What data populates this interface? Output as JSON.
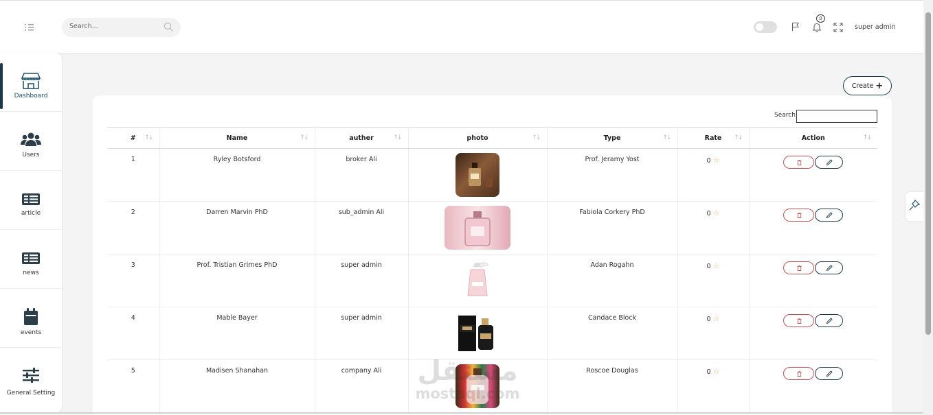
{
  "header": {
    "search_placeholder": "Search...",
    "notifications_count": "0",
    "user_name": "super admin"
  },
  "sidebar": {
    "items": [
      {
        "label": "Dashboard",
        "icon": "store-icon",
        "active": true
      },
      {
        "label": "Users",
        "icon": "users-icon"
      },
      {
        "label": "article",
        "icon": "article-icon"
      },
      {
        "label": "news",
        "icon": "news-icon"
      },
      {
        "label": "events",
        "icon": "calendar-icon"
      },
      {
        "label": "General Setting",
        "icon": "sliders-icon"
      }
    ]
  },
  "toolbar": {
    "create_label": "Create",
    "search_label": "Search:"
  },
  "table": {
    "columns": [
      "#",
      "Name",
      "auther",
      "photo",
      "Type",
      "Rate",
      "Action"
    ],
    "rows": [
      {
        "id": "1",
        "name": "Ryley Botsford",
        "auther": "broker Ali",
        "type": "Prof. Jeramy Yost",
        "rate": "0"
      },
      {
        "id": "2",
        "name": "Darren Marvin PhD",
        "auther": "sub_admin Ali",
        "type": "Fabiola Corkery PhD",
        "rate": "0"
      },
      {
        "id": "3",
        "name": "Prof. Tristian Grimes PhD",
        "auther": "super admin",
        "type": "Adan Rogahn",
        "rate": "0"
      },
      {
        "id": "4",
        "name": "Mable Bayer",
        "auther": "super admin",
        "type": "Candace Block",
        "rate": "0"
      },
      {
        "id": "5",
        "name": "Madisen Shanahan",
        "auther": "company Ali",
        "type": "Roscoe Douglas",
        "rate": "0"
      }
    ]
  },
  "watermark": {
    "arabic": "مستقل",
    "latin": "mostaql.com"
  },
  "colors": {
    "primary": "#1a3a4a",
    "danger": "#d04c4c",
    "star": "#e8b44a"
  }
}
